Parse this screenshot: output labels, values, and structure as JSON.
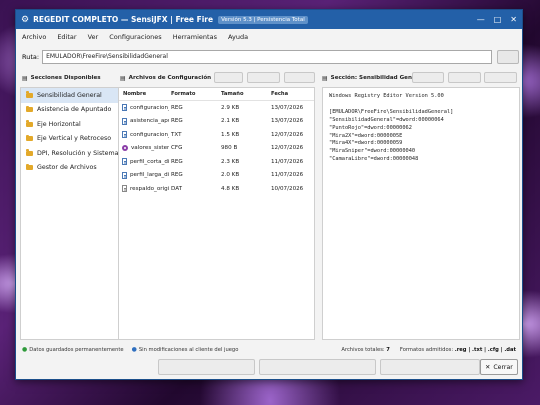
{
  "window": {
    "title": "REGEDIT COMPLETO — SensiJFX | Free Fire",
    "version_badge": "Versión 5.3 | Persistencia Total",
    "controls": [
      "—",
      "□",
      "✕"
    ]
  },
  "menu": [
    "Archivo",
    "Editar",
    "Ver",
    "Configuraciones",
    "Herramientas",
    "Ayuda"
  ],
  "path": {
    "label": "Ruta:",
    "value": "EMULADOR\\FreeFire\\SensibilidadGeneral"
  },
  "sections": {
    "header": "Secciones Disponibles",
    "items": [
      "Sensibilidad General",
      "Asistencia de Apuntado",
      "Eje Horizontal",
      "Eje Vertical y Retroceso",
      "DPI, Resolución y Sistema",
      "Gestor de Archivos"
    ],
    "active_index": 0
  },
  "files": {
    "header": "Archivos de Configuración",
    "columns": [
      "Nombre",
      "Formato",
      "Tamaño",
      "Fecha"
    ],
    "rows": [
      {
        "name": "configuracion_base.reg",
        "format": "REG",
        "size": "2.9 KB",
        "date": "13/07/2026",
        "icon": "reg-file-icon"
      },
      {
        "name": "asistencia_apuntado.reg",
        "format": "REG",
        "size": "2.1 KB",
        "date": "13/07/2026",
        "icon": "reg-file-icon"
      },
      {
        "name": "configuracion_dpi.txt",
        "format": "TXT",
        "size": "1.5 KB",
        "date": "12/07/2026",
        "icon": "reg-file-icon"
      },
      {
        "name": "valores_sistema.cfg",
        "format": "CFG",
        "size": "980 B",
        "date": "12/07/2026",
        "icon": "cfg-gear-icon"
      },
      {
        "name": "perfil_corta_distancia.reg",
        "format": "REG",
        "size": "2.3 KB",
        "date": "11/07/2026",
        "icon": "reg-file-icon"
      },
      {
        "name": "perfil_larga_distancia.reg",
        "format": "REG",
        "size": "2.0 KB",
        "date": "11/07/2026",
        "icon": "reg-file-icon"
      },
      {
        "name": "respaldo_original.dat",
        "format": "DAT",
        "size": "4.8 KB",
        "date": "10/07/2026",
        "icon": "dat-file-icon"
      }
    ]
  },
  "editor": {
    "header": "Sección: Sensibilidad General",
    "content": "Windows Registry Editor Version 5.00\n\n[EMULADOR\\FreeFire\\SensibilidadGeneral]\n\"SensibilidadGeneral\"=dword:00000064\n\"PuntoRojo\"=dword:00000062\n\"Mira2X\"=dword:0000005E\n\"Mira4X\"=dword:00000059\n\"MiraSniper\"=dword:00000040\n\"CamaraLibre\"=dword:00000048"
  },
  "status": {
    "saved": "Datos guardados permanentemente",
    "client": "Sin modificaciones al cliente del juego",
    "total_label": "Archivos totales:",
    "total_value": "7",
    "formats_label": "Formatos admitidos:",
    "formats_value": ".reg | .txt | .cfg | .dat"
  },
  "footer": {
    "close_label": "Cerrar"
  }
}
